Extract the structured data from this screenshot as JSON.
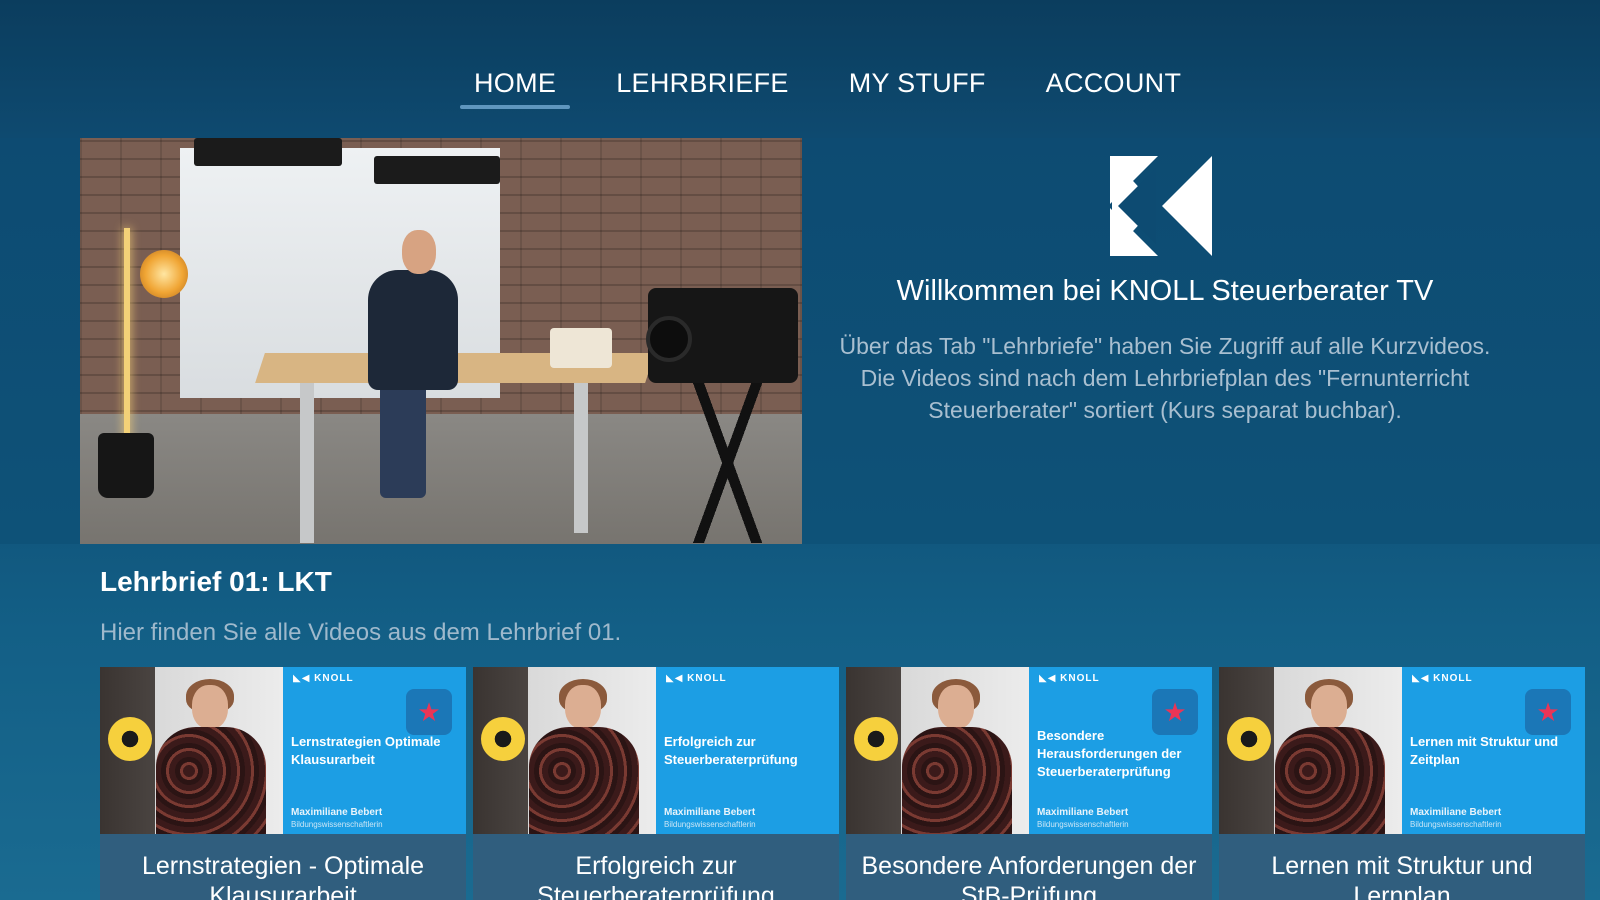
{
  "nav": {
    "items": [
      {
        "label": "HOME",
        "active": true
      },
      {
        "label": "LEHRBRIEFE",
        "active": false
      },
      {
        "label": "MY STUFF",
        "active": false
      },
      {
        "label": "ACCOUNT",
        "active": false
      }
    ]
  },
  "hero": {
    "welcome_title": "Willkommen bei KNOLL Steuerberater TV",
    "welcome_text": "Über das Tab \"Lehrbriefe\" haben Sie Zugriff auf alle Kurzvideos. Die Videos sind nach dem Lehrbriefplan des \"Fernunterricht Steuerberater\" sortiert (Kurs separat buchbar)."
  },
  "section": {
    "title": "Lehrbrief 01: LKT",
    "subtitle": "Hier finden Sie alle Videos aus dem Lehrbrief 01."
  },
  "cards": [
    {
      "label": "Lernstrategien - Optimale Klausurarbeit",
      "thumb_title": "Lernstrategien Optimale Klausurarbeit",
      "thumb_author": "Maximiliane Bebert",
      "thumb_author_sub": "Bildungswissenschaftlerin",
      "starred": true
    },
    {
      "label": "Erfolgreich zur Steuerberaterprüfung",
      "thumb_title": "Erfolgreich zur Steuerberaterprüfung",
      "thumb_author": "Maximiliane Bebert",
      "thumb_author_sub": "Bildungswissenschaftlerin",
      "starred": false
    },
    {
      "label": "Besondere Anforderungen der StB-Prüfung",
      "thumb_title": "Besondere Herausforderungen der Steuerberaterprüfung",
      "thumb_author": "Maximiliane Bebert",
      "thumb_author_sub": "Bildungswissenschaftlerin",
      "starred": true
    },
    {
      "label": "Lernen mit Struktur und Lernplan",
      "thumb_title": "Lernen mit Struktur und Zeitplan",
      "thumb_author": "Maximiliane Bebert",
      "thumb_author_sub": "Bildungswissenschaftlerin",
      "starred": true
    }
  ],
  "colors": {
    "background": "#0d4a70",
    "nav_underline": "#5f96be",
    "thumb_blue": "#1c9ee4",
    "star": "#ea3556"
  },
  "icons": {
    "logo": "knoll-logo",
    "star": "star-icon"
  }
}
